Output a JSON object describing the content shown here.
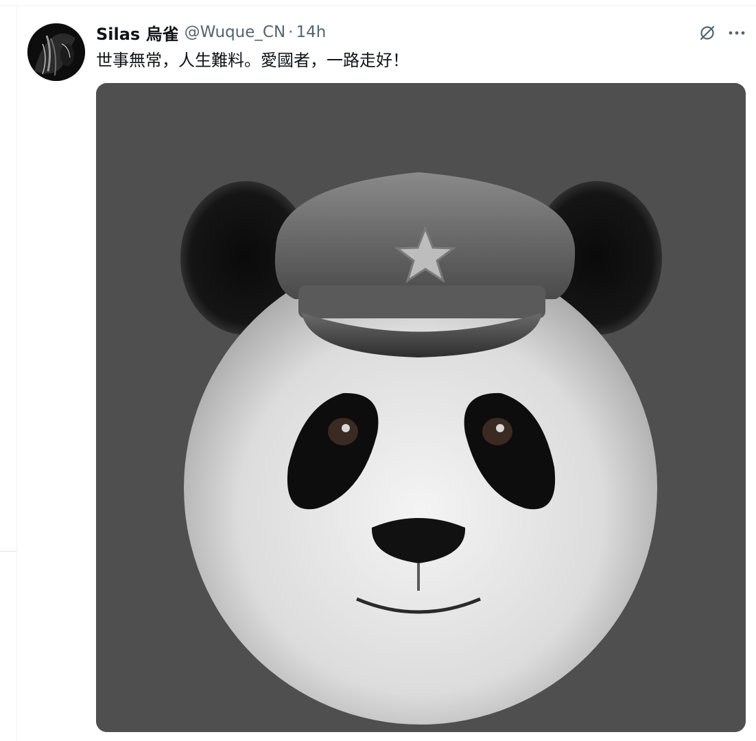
{
  "tweet": {
    "author_name": "Silas 烏雀",
    "handle": "@Wuque_CN",
    "separator": "·",
    "time": "14h",
    "text": "世事無常，人生難料。愛國者，一路走好！"
  },
  "icons": {
    "grok": "grok-icon",
    "more": "more-icon"
  },
  "media": {
    "subject": "panda-wearing-star-cap"
  },
  "colors": {
    "text_primary": "#0f1419",
    "text_secondary": "#536471",
    "border": "#eff3f4",
    "media_background": "#4e4e4e"
  }
}
